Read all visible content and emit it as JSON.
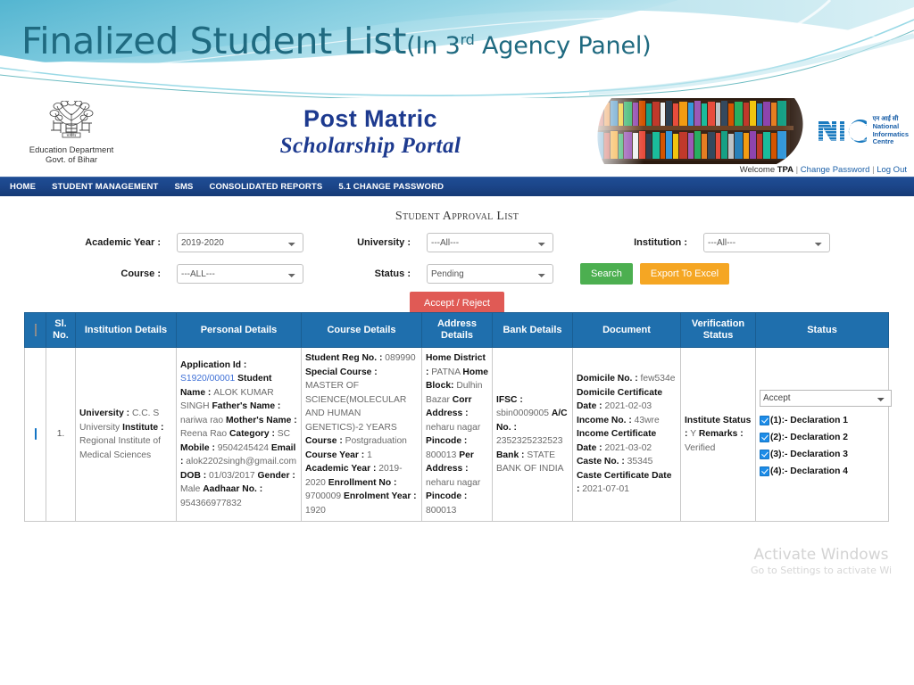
{
  "slide": {
    "title_main": "Finalized Student List",
    "title_sub_pre": "(In 3",
    "title_sub_sup": "rd",
    "title_sub_post": " Agency Panel)"
  },
  "portal": {
    "dept_line1": "Education Department",
    "dept_line2": "Govt. of Bihar",
    "title_line1": "Post Matric",
    "title_line2": "Scholarship Portal",
    "nic_mark": "NIC",
    "nic_hindi": "एन आई सी",
    "nic_line1": "National",
    "nic_line2": "Informatics",
    "nic_line3": "Centre"
  },
  "welcome": {
    "prefix": "Welcome ",
    "user": "TPA",
    "change_password": "Change Password",
    "logout": "Log Out"
  },
  "nav": {
    "items": [
      {
        "label": "HOME"
      },
      {
        "label": "STUDENT MANAGEMENT"
      },
      {
        "label": "SMS"
      },
      {
        "label": "CONSOLIDATED REPORTS"
      },
      {
        "label": "5.1 CHANGE PASSWORD"
      }
    ]
  },
  "page": {
    "heading": "Student Approval List"
  },
  "filters": {
    "academic_year_label": "Academic Year :",
    "academic_year_value": "2019-2020",
    "university_label": "University :",
    "university_value": "---All---",
    "institution_label": "Institution :",
    "institution_value": "---All---",
    "course_label": "Course :",
    "course_value": "---ALL---",
    "status_label": "Status :",
    "status_value": "Pending",
    "search_button": "Search",
    "export_button": "Export To Excel",
    "accept_reject_button": "Accept / Reject"
  },
  "table": {
    "headers": [
      "",
      "Sl. No.",
      "Institution Details",
      "Personal Details",
      "Course Details",
      "Address Details",
      "Bank Details",
      "Document",
      "Verification Status",
      "Status"
    ],
    "rows": [
      {
        "sl_no": "1.",
        "selected": true,
        "institution": [
          {
            "key": "University : ",
            "value": "C.C. S University"
          },
          {
            "key": "Institute : ",
            "value": "Regional Institute of Medical Sciences"
          }
        ],
        "personal": [
          {
            "key": "Application Id : ",
            "value": "S1920/00001",
            "link": true
          },
          {
            "key": "Student Name : ",
            "value": "ALOK KUMAR SINGH"
          },
          {
            "key": "Father's Name : ",
            "value": "nariwa rao"
          },
          {
            "key": "Mother's Name : ",
            "value": "Reena Rao"
          },
          {
            "key": "Category : ",
            "value": "SC"
          },
          {
            "key": "Mobile : ",
            "value": "9504245424"
          },
          {
            "key": "Email : ",
            "value": "alok2202singh@gmail.com"
          },
          {
            "key": "DOB : ",
            "value": "01/03/2017"
          },
          {
            "key": "Gender : ",
            "value": "Male"
          },
          {
            "key": "Aadhaar No. : ",
            "value": "954366977832"
          }
        ],
        "course": [
          {
            "key": "Student Reg No. : ",
            "value": "089990"
          },
          {
            "key": "Special Course : ",
            "value": "MASTER OF SCIENCE(MOLECULAR AND HUMAN GENETICS)-2 YEARS"
          },
          {
            "key": "Course : ",
            "value": "Postgraduation"
          },
          {
            "key": "Course Year : ",
            "value": "1"
          },
          {
            "key": "Academic Year : ",
            "value": "2019-2020"
          },
          {
            "key": "Enrollment No : ",
            "value": "9700009"
          },
          {
            "key": "Enrolment Year : ",
            "value": "1920"
          }
        ],
        "address": [
          {
            "key": "Home District : ",
            "value": "PATNA"
          },
          {
            "key": "Home Block: ",
            "value": "Dulhin Bazar"
          },
          {
            "key": "Corr Address : ",
            "value": "neharu nagar"
          },
          {
            "key": "Pincode : ",
            "value": "800013"
          },
          {
            "key": "Per Address : ",
            "value": "neharu nagar"
          },
          {
            "key": "Pincode : ",
            "value": "800013"
          }
        ],
        "bank": [
          {
            "key": "IFSC : ",
            "value": "sbin0009005"
          },
          {
            "key": "A/C No. : ",
            "value": "2352325232523"
          },
          {
            "key": "Bank : ",
            "value": "STATE BANK OF INDIA"
          }
        ],
        "document": [
          {
            "key": "Domicile No. : ",
            "value": "few534e"
          },
          {
            "key": "Domicile Certificate Date : ",
            "value": "2021-02-03"
          },
          {
            "key": "Income No. : ",
            "value": "43wre"
          },
          {
            "key": "Income Certificate Date : ",
            "value": "2021-03-02"
          },
          {
            "key": "Caste No. : ",
            "value": "35345"
          },
          {
            "key": "Caste Certificate Date : ",
            "value": "2021-07-01"
          }
        ],
        "verification": [
          {
            "key": "Institute Status : ",
            "value": "Y"
          },
          {
            "key": "Remarks : ",
            "value": "Verified"
          }
        ],
        "status_select_value": "Accept",
        "declarations": [
          {
            "label": "(1):- Declaration 1",
            "checked": true
          },
          {
            "label": "(2):- Declaration 2",
            "checked": true
          },
          {
            "label": "(3):- Declaration 3",
            "checked": true
          },
          {
            "label": "(4):- Declaration 4",
            "checked": true
          }
        ]
      }
    ]
  },
  "watermark": {
    "line1": "Activate Windows",
    "line2": "Go to Settings to activate Wi"
  },
  "colors": {
    "slide_title": "#1f6a80",
    "nav_bar": "#1b4487",
    "table_header": "#1f6fad",
    "search_button": "#4caf50",
    "export_button": "#f5a623",
    "accept_button": "#e05a55",
    "link": "#1a5fa8",
    "portal_title": "#1d3a8f"
  }
}
